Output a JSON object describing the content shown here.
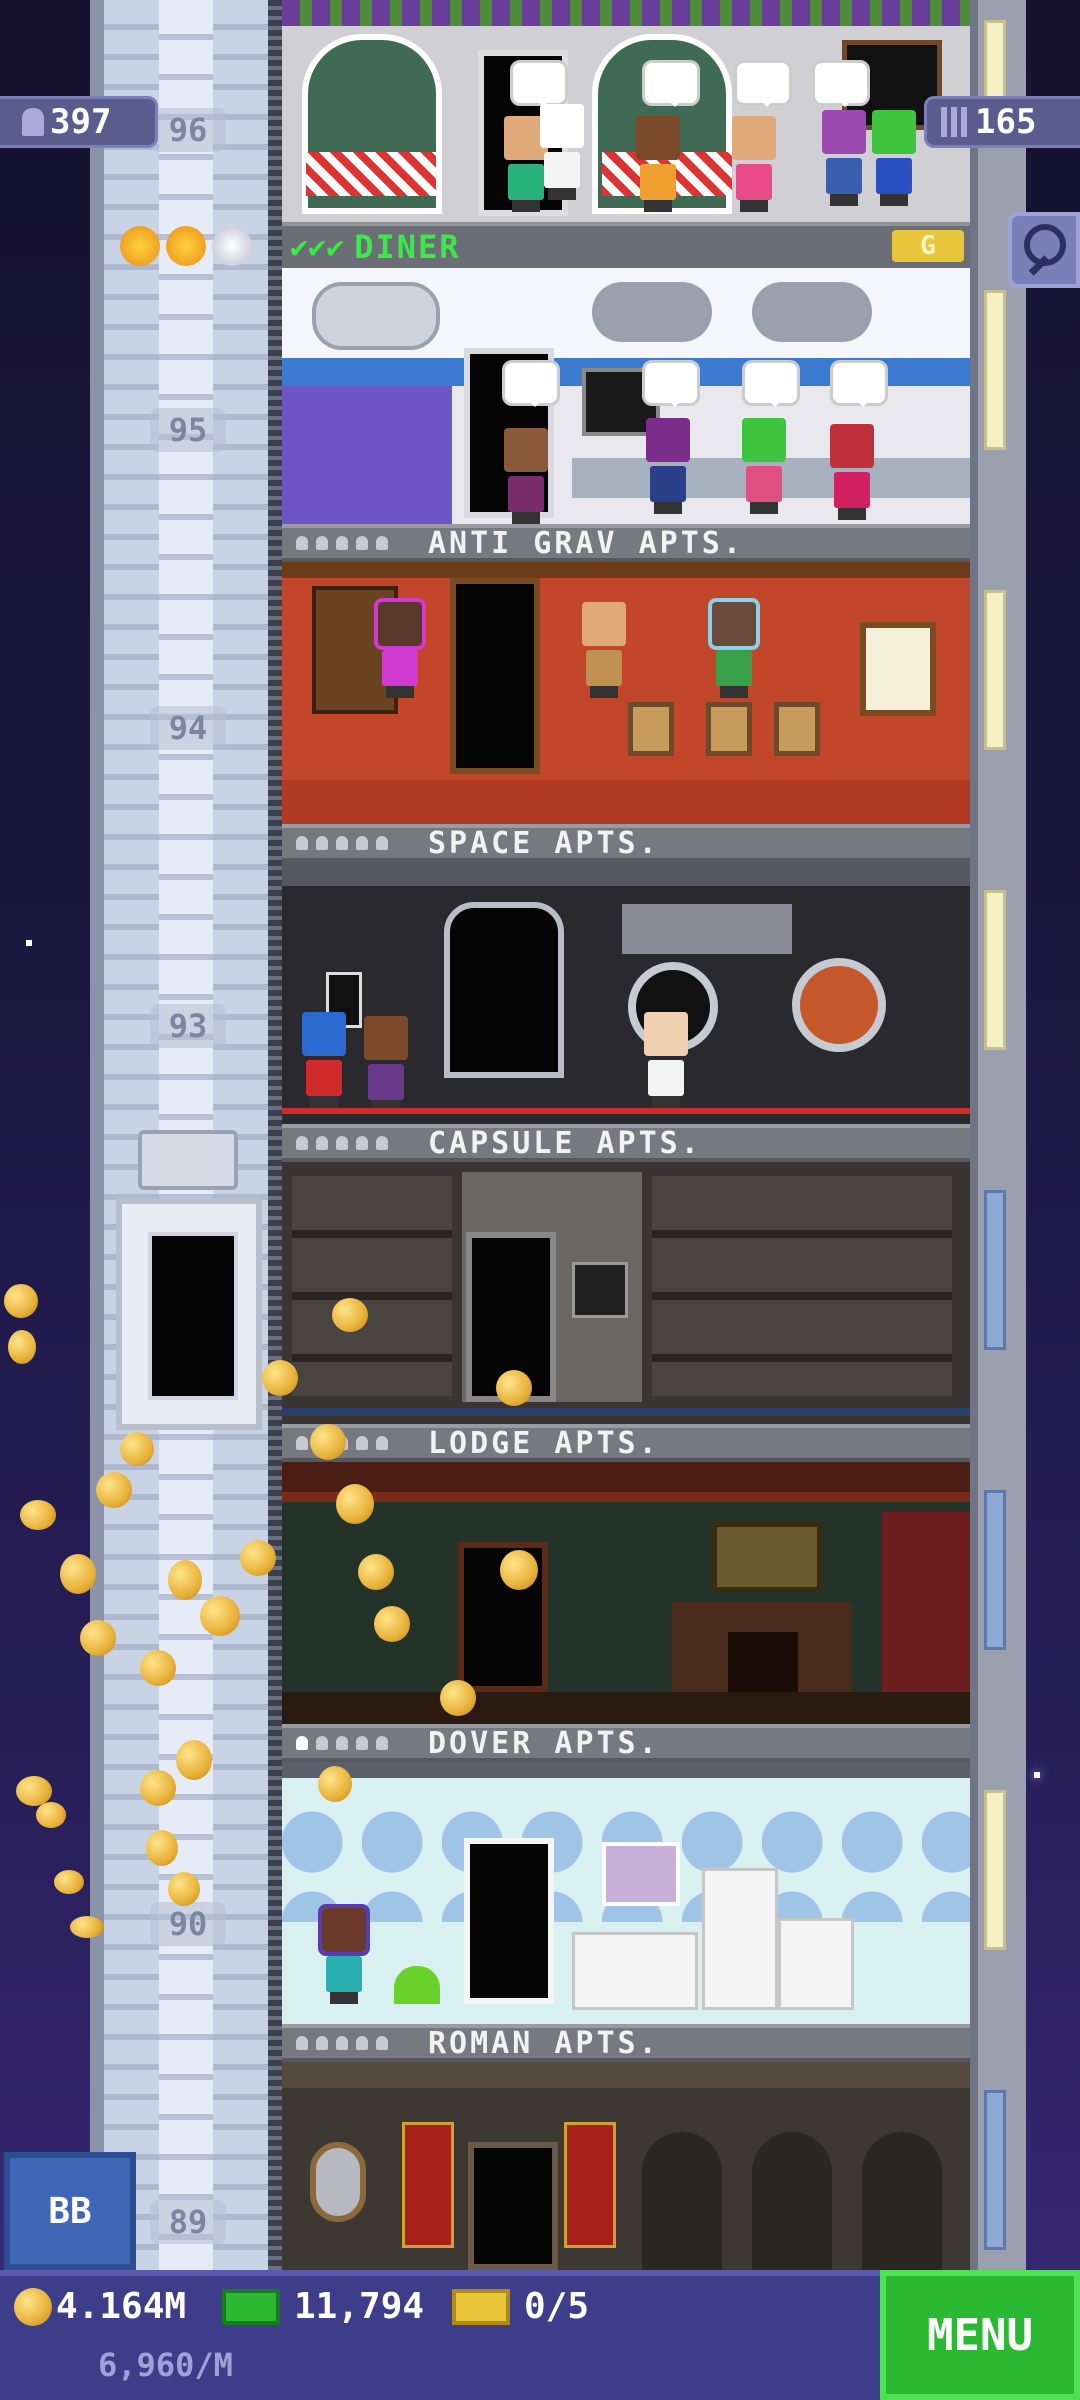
{
  "hud": {
    "population": "397",
    "floors": "165",
    "coins": "4.164M",
    "coin_rate": "6,960/M",
    "bux": "11,794",
    "tickets": "0/5",
    "bb_label": "BB",
    "menu_label": "MENU"
  },
  "diner": {
    "name": "DINER",
    "checks": "✔✔✔",
    "badge": "G",
    "stars_filled": 2,
    "stars_total": 3
  },
  "floor_numbers": [
    "96",
    "95",
    "94",
    "93",
    "90",
    "89"
  ],
  "floors": [
    {
      "name": "ANTI GRAV APTS."
    },
    {
      "name": "SPACE APTS."
    },
    {
      "name": "CAPSULE APTS."
    },
    {
      "name": "LODGE APTS."
    },
    {
      "name": "DOVER APTS."
    },
    {
      "name": "ROMAN APTS."
    }
  ],
  "icons": [
    "person-icon",
    "floors-icon",
    "search-icon",
    "star-icon",
    "coin-icon",
    "bux-icon",
    "ticket-icon",
    "elevator-icon"
  ],
  "colors": {
    "background": "#1c1740",
    "bottom_bar": "#3d3d8a",
    "menu_button": "#2bb832",
    "diner_label": "#3ee84a",
    "coin": "#e8b23a"
  }
}
